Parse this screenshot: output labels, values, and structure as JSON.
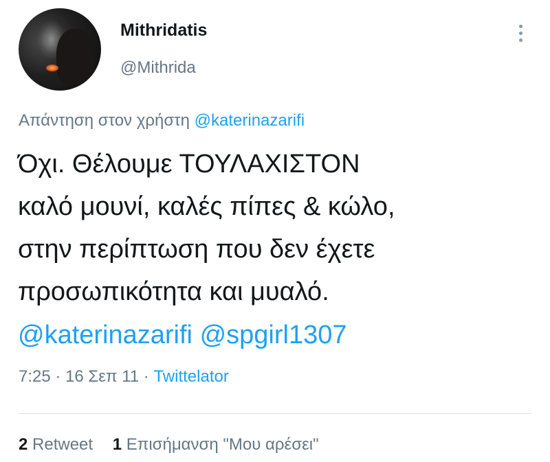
{
  "author": {
    "display_name": "Mithridatis",
    "handle": "@Mithrida"
  },
  "reply_context": {
    "prefix": "Απάντηση στον χρήστη",
    "mention": "@katerinazarifi"
  },
  "tweet": {
    "text_lines": [
      "Όχι. Θέλουμε ΤΟΥΛΑΧΙΣΤΟΝ",
      "καλό μουνί, καλές πίπες & κώλο,",
      "στην περίπτωση που δεν έχετε",
      "προσωπικότητα και μυαλό."
    ],
    "mentions": [
      "@katerinazarifi",
      "@spgirl1307"
    ]
  },
  "meta": {
    "time": "7:25",
    "date": "16 Σεπ 11",
    "source": "Twittelator",
    "separator": "·"
  },
  "stats": {
    "retweets": {
      "count": "2",
      "label": "Retweet"
    },
    "likes": {
      "count": "1",
      "label": "Επισήμανση \"Μου αρέσει\""
    }
  },
  "icons": {
    "more": "more-vertical-icon"
  },
  "colors": {
    "link": "#1da1f2",
    "secondary_text": "#657786",
    "primary_text": "#14171a"
  }
}
